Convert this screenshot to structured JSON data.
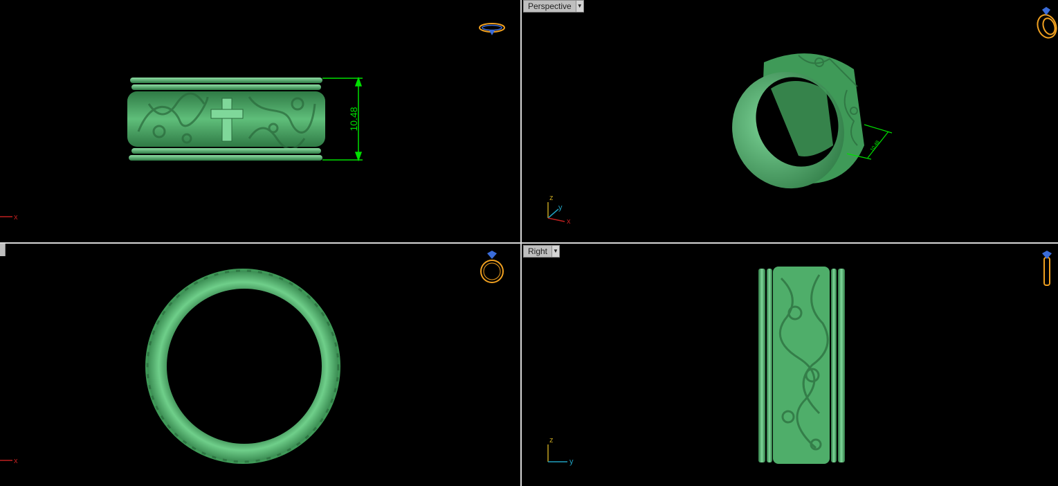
{
  "viewports": {
    "top_left": {
      "dimension": "10.48",
      "axis_x": "x"
    },
    "top_right": {
      "label": "Perspective",
      "dimension": "10.48",
      "axis_x": "x",
      "axis_y": "y",
      "axis_z": "z"
    },
    "bottom_left": {
      "axis_x": "x"
    },
    "bottom_right": {
      "label": "Right",
      "axis_y": "y",
      "axis_z": "z"
    }
  },
  "colors": {
    "ring_green": "#4fae6a",
    "dimension_green": "#00e000",
    "gizmo_orange": "#f0a020",
    "gizmo_blue": "#3a6cd8",
    "axis_red": "#c02020",
    "axis_green": "#20a020",
    "axis_cyan": "#20a0c0",
    "axis_yellow": "#c0a020",
    "divider": "#d8d8d8",
    "label_bg": "#bfbfbf"
  },
  "icons": {
    "view_gizmo": "ring-gizmo-icon",
    "dropdown": "chevron-down-icon"
  }
}
